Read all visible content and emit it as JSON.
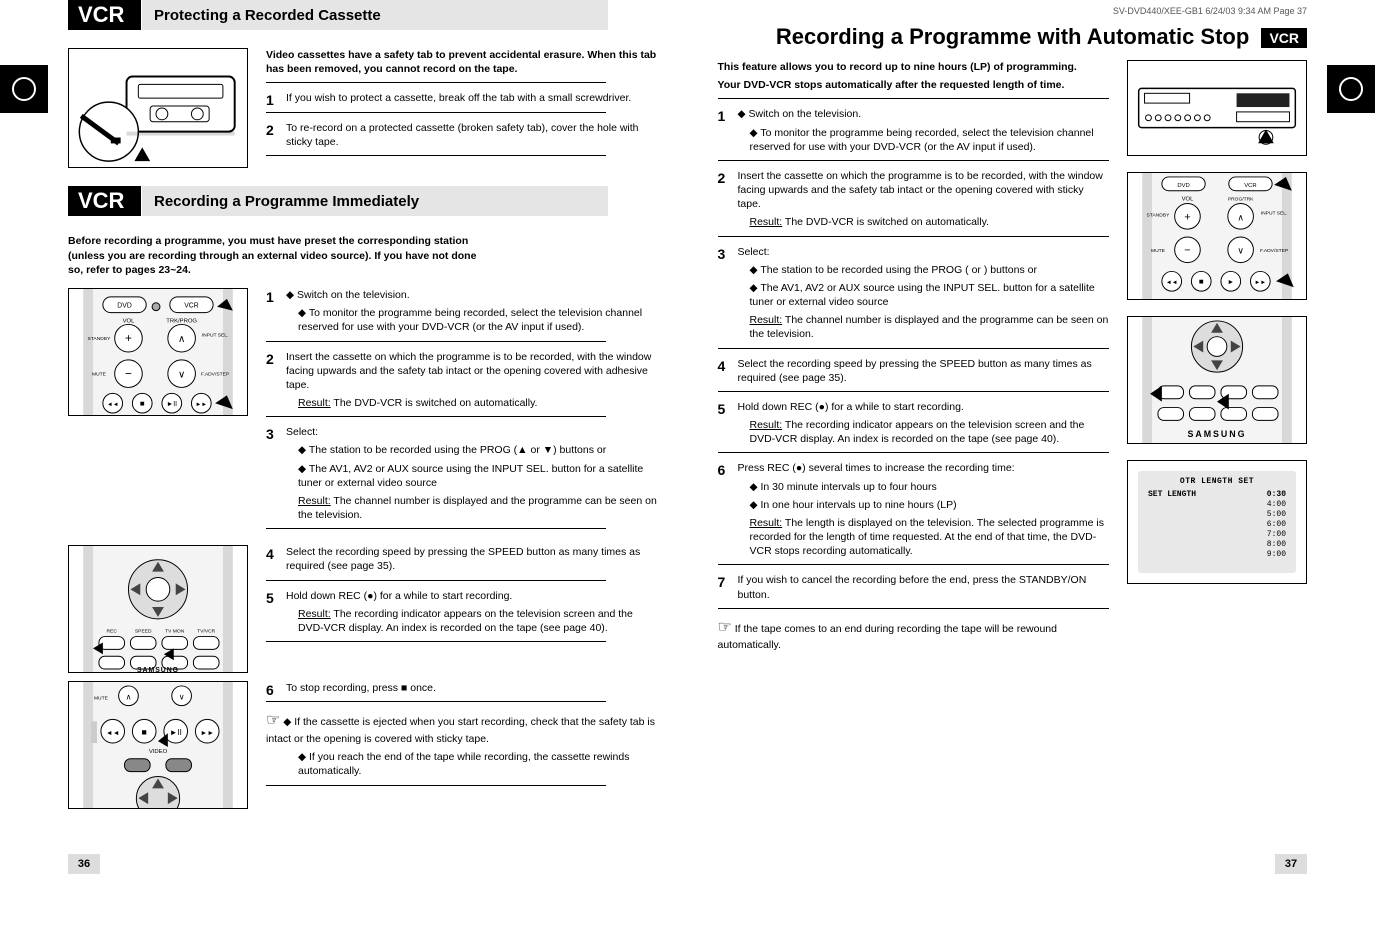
{
  "left": {
    "tab": "VCR",
    "section_a": {
      "label": "VCR",
      "title": "Protecting a Recorded Cassette",
      "body1": "Video cassettes have a safety tab to prevent accidental erasure. When this tab has been removed, you cannot record on the tape.",
      "step1_num": "1",
      "step1": "If you wish to protect a cassette, break off the tab with a small screwdriver.",
      "step2_num": "2",
      "step2": "To re-record on a protected cassette (broken safety tab), cover the hole with sticky tape."
    },
    "section_b": {
      "label": "VCR",
      "title": "Recording a Programme Immediately",
      "intro": "Before recording a programme, you must have preset the corresponding station (unless you are recording through an external video source). If you have not done so, refer to pages 23~24.",
      "s1_num": "1",
      "s1a": "Switch on the television.",
      "s1b": "To monitor the programme being recorded, select the television channel reserved for use with your DVD-VCR (or the AV input if used).",
      "s2_num": "2",
      "s2": "Insert the cassette on which the programme is to be recorded, with the window facing upwards and the safety tab intact or the opening covered with adhesive tape.",
      "s2_result_label": "Result:",
      "s2_result": "The DVD-VCR is switched on automatically.",
      "s3_num": "3",
      "s3": "Select:",
      "s3a": "The station to be recorded using the PROG (▲ or ▼) buttons or",
      "s3b": "The AV1, AV2 or AUX source using the INPUT SEL. button for a satellite tuner or external video source",
      "s3_result_label": "Result:",
      "s3_result": "The channel number is displayed and the programme can be seen on the television.",
      "s4_num": "4",
      "s4": "Select the recording speed by pressing the SPEED button as many times as required (see page 35).",
      "s5_num": "5",
      "s5": "Hold down REC (●) for a while to start recording.",
      "s5_result_label": "Result:",
      "s5_result": "The recording indicator appears on the television screen and the DVD-VCR display. An index is recorded on the tape (see page 40).",
      "s6_num": "6",
      "s6": "To stop recording, press ■ once.",
      "notes_icon": "☞",
      "note1": "If the cassette is ejected when you start recording, check that the safety tab is intact or the opening is covered with sticky tape.",
      "note2": "If you reach the end of the tape while recording, the cassette rewinds automatically."
    },
    "page_num": "36"
  },
  "right": {
    "hdr_small": "SV-DVD440/XEE-GB1  6/24/03 9:34 AM  Page 37",
    "title": "Recording a Programme with Automatic Stop",
    "badge": "VCR",
    "intro": "This feature allows you to record up to nine hours (LP) of programming.",
    "intro2": "Your DVD-VCR stops automatically after the requested length of time.",
    "s1_num": "1",
    "s1a": "Switch on the television.",
    "s1b": "To monitor the programme being recorded, select the television channel reserved for use with your DVD-VCR (or the AV input if used).",
    "s2_num": "2",
    "s2": "Insert the cassette on which the programme is to be recorded, with the window facing upwards and the safety tab intact or the opening covered with sticky tape.",
    "s2_result_label": "Result:",
    "s2_result": "The DVD-VCR is switched on automatically.",
    "s3_num": "3",
    "s3": "Select:",
    "s3a": "The station to be recorded using the PROG (      or      ) buttons or",
    "s3b": "The AV1, AV2 or AUX source using the INPUT SEL. button for a satellite tuner or external video source",
    "s3_result_label": "Result:",
    "s3_result": "The channel number is displayed and the programme can be seen on the television.",
    "s4_num": "4",
    "s4": "Select the recording speed by pressing the SPEED button as many times as required (see page 35).",
    "s5_num": "5",
    "s5": "Hold down REC (●) for a while to start recording.",
    "s5_result_label": "Result:",
    "s5_result": "The recording indicator appears on the television screen and the DVD-VCR display. An index is recorded on the tape (see page 40).",
    "s6_num": "6",
    "s6": "Press REC (●) several times to increase the recording time:",
    "s6a": "In 30 minute intervals up to four hours",
    "s6b": "In one hour intervals up to nine hours (LP)",
    "s6_result_label": "Result:",
    "s6_result": "The length is displayed on the television. The selected programme is recorded for the length of time requested. At the end of that time, the DVD-VCR stops recording automatically.",
    "s7_num": "7",
    "s7": "If you wish to cancel the recording before the end, press the STANDBY/ON button.",
    "note_icon": "☞",
    "note": "If the tape comes to an end during recording the tape will be rewound automatically.",
    "osd": {
      "title": "OTR LENGTH SET",
      "lines": [
        [
          "SET LENGTH",
          "0:30"
        ],
        [
          "",
          "4:00"
        ],
        [
          "",
          "5:00"
        ],
        [
          "",
          "6:00"
        ],
        [
          "",
          "7:00"
        ],
        [
          "",
          "8:00"
        ],
        [
          "",
          "9:00"
        ]
      ]
    },
    "page_num": "37"
  }
}
